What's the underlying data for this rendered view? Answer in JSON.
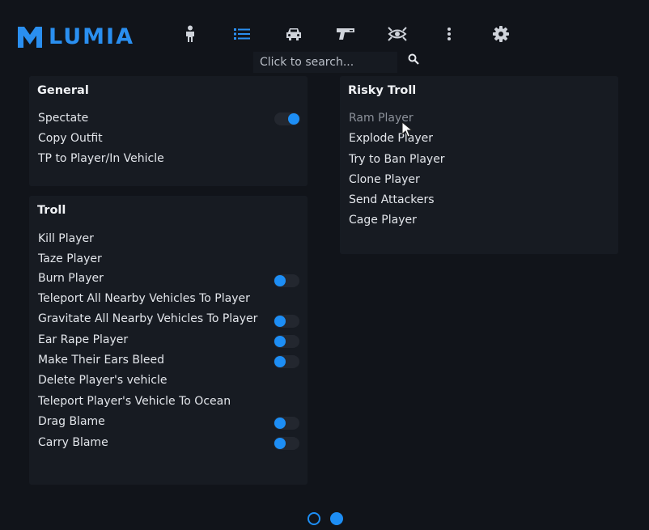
{
  "brand": {
    "name": "LUMIA",
    "color": "#2a8ff0"
  },
  "nav": {
    "icons": [
      "person-icon",
      "list-icon",
      "car-icon",
      "gun-icon",
      "eye-icon",
      "more-vertical-icon",
      "gear-icon"
    ],
    "active": "list-icon"
  },
  "search": {
    "placeholder": "Click to search..."
  },
  "panels": {
    "general": {
      "title": "General",
      "items": [
        {
          "label": "Spectate",
          "toggle": "on"
        },
        {
          "label": "Copy Outfit"
        },
        {
          "label": "TP to Player/In Vehicle"
        }
      ]
    },
    "troll": {
      "title": "Troll",
      "items": [
        {
          "label": "Kill Player"
        },
        {
          "label": "Taze Player"
        },
        {
          "label": "Burn Player",
          "toggle": "off"
        },
        {
          "label": "Teleport All Nearby Vehicles To Player"
        },
        {
          "label": "Gravitate All Nearby Vehicles To Player",
          "toggle": "off"
        },
        {
          "label": "Ear Rape Player",
          "toggle": "off"
        },
        {
          "label": "Make Their Ears Bleed",
          "toggle": "off"
        },
        {
          "label": "Delete Player's vehicle"
        },
        {
          "label": "Teleport Player's Vehicle To Ocean"
        },
        {
          "label": "Drag Blame",
          "toggle": "off"
        },
        {
          "label": "Carry Blame",
          "toggle": "off"
        }
      ]
    },
    "risky_troll": {
      "title": "Risky Troll",
      "items": [
        {
          "label": "Ram Player",
          "state": "hovered"
        },
        {
          "label": "Explode Player"
        },
        {
          "label": "Try to Ban Player"
        },
        {
          "label": "Clone Player"
        },
        {
          "label": "Send Attackers"
        },
        {
          "label": "Cage Player"
        }
      ]
    }
  },
  "pagination": {
    "pages": 2,
    "current": 2
  },
  "colors": {
    "accent": "#1d8ef5",
    "background": "#11141a",
    "panel": "#171b22"
  }
}
